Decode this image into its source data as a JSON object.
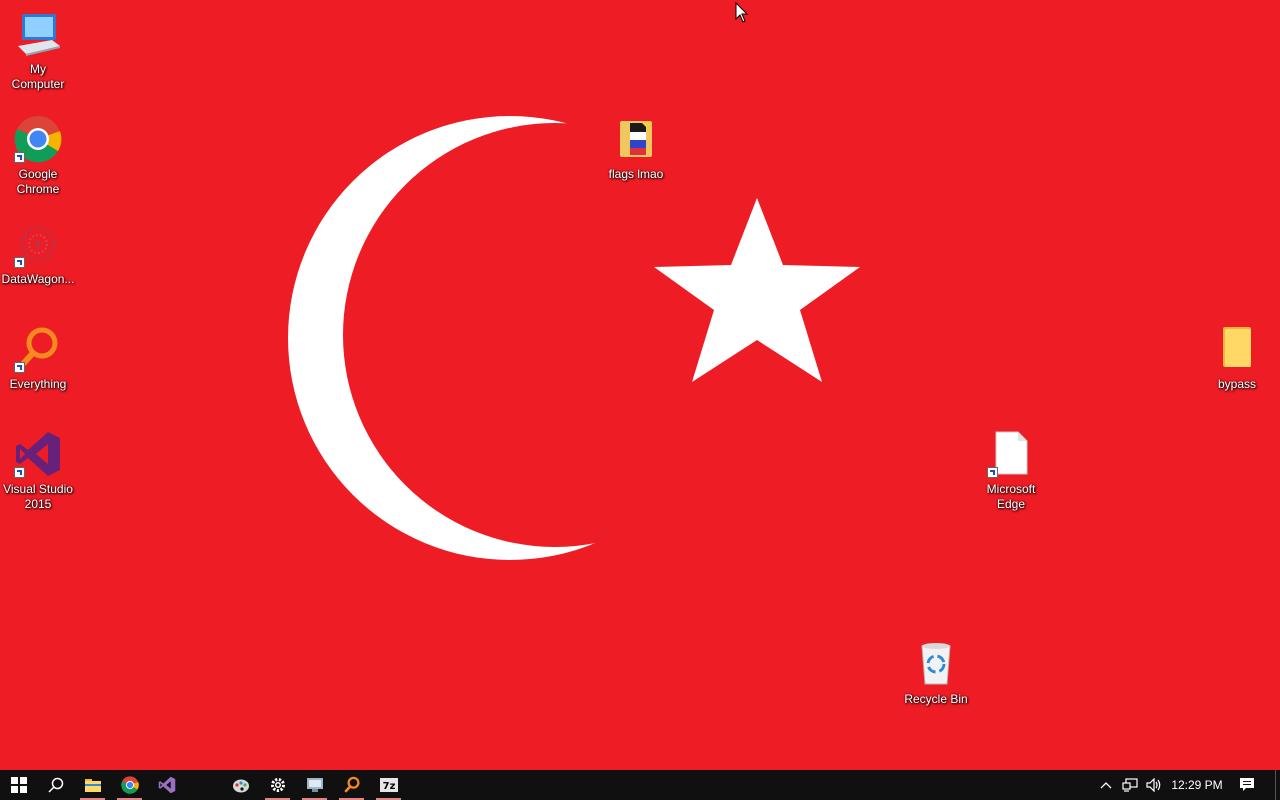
{
  "desktop": {
    "icons": [
      {
        "label": "My\nComputer",
        "icon": "computer-icon",
        "shortcut": false
      },
      {
        "label": "Google\nChrome",
        "icon": "chrome-icon",
        "shortcut": true
      },
      {
        "label": "DataWagon...",
        "icon": "datawagon-icon",
        "shortcut": true
      },
      {
        "label": "Everything",
        "icon": "everything-search-icon",
        "shortcut": true
      },
      {
        "label": "Visual Studio\n2015",
        "icon": "visual-studio-icon",
        "shortcut": true
      },
      {
        "label": "flags lmao",
        "icon": "folder-with-flags-icon",
        "shortcut": false
      },
      {
        "label": "bypass",
        "icon": "folder-icon",
        "shortcut": false
      },
      {
        "label": "Microsoft\nEdge",
        "icon": "blank-document-icon",
        "shortcut": true
      },
      {
        "label": "Recycle Bin",
        "icon": "recycle-bin-icon",
        "shortcut": false
      }
    ]
  },
  "taskbar": {
    "buttons": [
      {
        "name": "start-button",
        "icon": "windows-logo-icon",
        "running": false
      },
      {
        "name": "search-button",
        "icon": "search-icon",
        "running": false
      },
      {
        "name": "file-explorer-button",
        "icon": "folder-icon",
        "running": true
      },
      {
        "name": "chrome-button",
        "icon": "chrome-icon",
        "running": true
      },
      {
        "name": "visual-studio-button",
        "icon": "visual-studio-icon",
        "running": false
      },
      {
        "name": "paint-button",
        "icon": "paint-palette-icon",
        "running": false
      },
      {
        "name": "settings-button",
        "icon": "gear-icon",
        "running": true
      },
      {
        "name": "remote-desktop-button",
        "icon": "remote-desktop-icon",
        "running": true
      },
      {
        "name": "everything-button",
        "icon": "everything-search-icon",
        "running": true
      },
      {
        "name": "7zip-button",
        "icon": "7zip-icon",
        "running": true
      }
    ],
    "tray": {
      "clock": "12:29 PM",
      "icons": [
        "chevron-up-icon",
        "network-icon",
        "volume-icon",
        "action-center-icon"
      ]
    }
  },
  "colors": {
    "wallpaper": "#ee1c25",
    "taskbar": "#101010"
  }
}
